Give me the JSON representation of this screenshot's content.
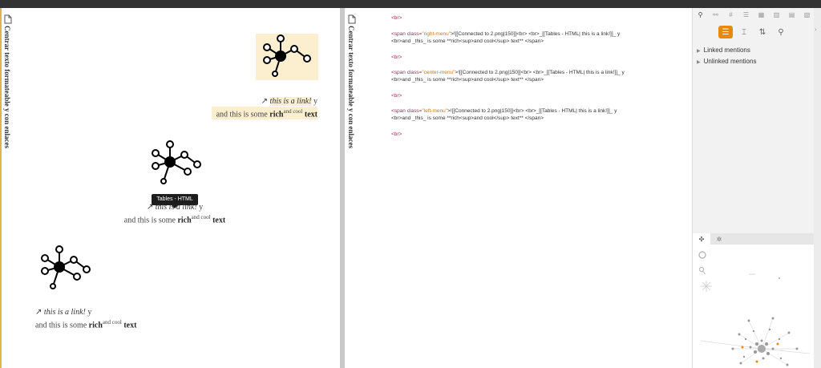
{
  "note_title": "Centrar texto formateable y con enlaces",
  "preview_blocks": [
    {
      "link": "this is a link!",
      "after_link": " y",
      "line2_pre": "and this is some ",
      "rich": "rich",
      "sup": "and cool",
      "line2_post": " text"
    },
    {
      "link": "this is a link!",
      "after_link": " y",
      "line2_pre": "and this is some ",
      "rich": "rich",
      "sup": "and cool",
      "line2_post": " text"
    },
    {
      "link": "this is a link!",
      "after_link": " y",
      "line2_pre": "and this is some ",
      "rich": "rich",
      "sup": "and cool",
      "line2_post": " text"
    }
  ],
  "tooltip": "Tables - HTML",
  "source": {
    "br": "<br>",
    "blocks": [
      {
        "open": "<span ",
        "attr": "class=",
        "cls": "\"right-menu\"",
        "rest1": ">![[Connected to 2.png|150]]<br> <br>_[[Tables - HTML| this is a link!]]_ y",
        "line2": "<br>and _this_ is some **rich<sup>and cool</sup> text** </span>"
      },
      {
        "open": "<span ",
        "attr": "class=",
        "cls": "\"center-menu\"",
        "rest1": ">![[Connected to 2.png|150]]<br> <br>_[[Tables - HTML| this is a link!]]_ y",
        "line2": "<br>and _this_ is some **rich<sup>and cool</sup> text** </span>"
      },
      {
        "open": "<span ",
        "attr": "class=",
        "cls": "\"left-menu\"",
        "rest1": ">![[Connected to 2.png|150]]<br> <br>_[[Tables - HTML| this is a link!]]_ y",
        "line2": "<br>and _this_ is some **rich<sup>and cool</sup> text** </span>"
      }
    ]
  },
  "sidebar": {
    "linked_mentions": "Linked mentions",
    "unlinked_mentions": "Unlinked mentions"
  },
  "colors": {
    "accent": "#e8890c",
    "highlight": "#fbefcf",
    "tag": "#9b2d5a",
    "string": "#c17a2a"
  }
}
